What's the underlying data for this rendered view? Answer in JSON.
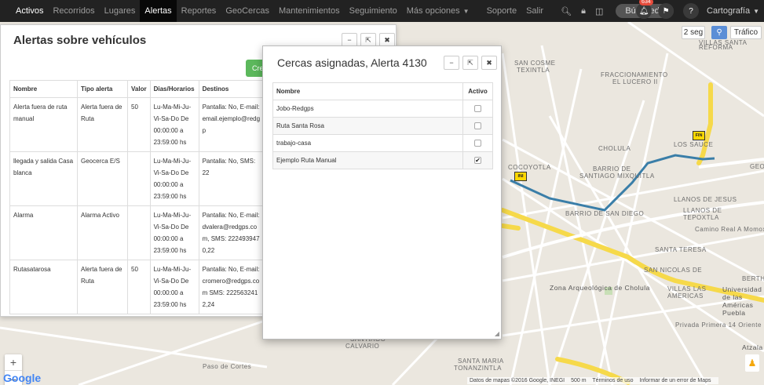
{
  "nav": {
    "items": [
      {
        "label": "Activos",
        "active": false,
        "bold": true
      },
      {
        "label": "Recorridos"
      },
      {
        "label": "Lugares"
      },
      {
        "label": "Alertas",
        "active": true
      },
      {
        "label": "Reportes"
      },
      {
        "label": "GeoCercas"
      },
      {
        "label": "Mantenimientos"
      },
      {
        "label": "Seguimiento"
      },
      {
        "label": "Más opciones"
      }
    ],
    "soporte": "Soporte",
    "salir": "Salir",
    "busqueda": "Búsqueda",
    "notif_count": "634",
    "cartografia": "Cartografía"
  },
  "map": {
    "refresh": "2 seg",
    "trafico": "Tráfico",
    "labels": {
      "reforma": "REFORMA",
      "villas_santa": "VILLAS SANTA",
      "san_cosme": "SAN COSME",
      "texintla": "TEXINTLA",
      "fracc": "FRACCIONAMIENTO",
      "el_lucero": "EL LUCERO II",
      "cholula": "CHOLULA",
      "barrio_santiago": "BARRIO DE",
      "santiago_mixquitla": "SANTIAGO MIXQUITLA",
      "cocoyotla": "COCOYOTLA",
      "barrio_san_diego": "BARRIO DE SAN DIEGO",
      "llanos_jesus": "LLANOS DE JESUS",
      "llanos_tepoxtla": "LLANOS DE",
      "tepoxtla": "TEPOXTLA",
      "santa_teresa": "SANTA TERESA",
      "san_nicolas": "SAN NICOLAS DE",
      "zona_arq": "Zona Arqueológica de Cholula",
      "villas_americas": "VILLAS LAS AMERICAS",
      "udlap": "Universidad de las Américas Puebla",
      "santa_maria": "SANTA MARIA",
      "tonanzintla": "TONANZINTLA",
      "calvario": "CALVARIO",
      "barrio_santiago2": "SANTIAGO",
      "camino_real": "Camino Real A Momoxpan",
      "privada_primera": "Privada Primera 14 Oriente",
      "paso_cortes": "Paso de Cortes",
      "geov": "GEOV",
      "los_sauce": "LOS SAUCE",
      "berth": "BERTH",
      "atzala": "Atzala"
    },
    "attribution": {
      "data": "Datos de mapas ©2016 Google, INEGI",
      "scale": "500 m",
      "terms": "Términos de uso",
      "report": "Informar de un error de Maps"
    },
    "markers": {
      "start": "INI",
      "end": "FIN"
    },
    "google": "Google"
  },
  "alertas_panel": {
    "title": "Alertas sobre vehículos",
    "create_label": "Cre",
    "headers": [
      "Nombre",
      "Tipo alerta",
      "Valor",
      "Dias/Horarios",
      "Destinos"
    ],
    "rows": [
      {
        "nombre": "Alerta fuera de ruta manual",
        "tipo": "Alerta fuera de Ruta",
        "valor": "50",
        "horario": "Lu-Ma-Mi-Ju-Vi-Sa-Do De 00:00:00 a 23:59:00 hs",
        "destinos": "Pantalla: No,  E-mail: email.ejemplo@redgp"
      },
      {
        "nombre": "llegada y salida Casa blanca",
        "tipo": "Geocerca E/S",
        "valor": "",
        "horario": "Lu-Ma-Mi-Ju-Vi-Sa-Do De 00:00:00 a 23:59:00 hs",
        "destinos": "Pantalla: No,  SMS: 22"
      },
      {
        "nombre": "Alarma",
        "tipo": "Alarma Activo",
        "valor": "",
        "horario": "Lu-Ma-Mi-Ju-Vi-Sa-Do De 00:00:00 a 23:59:00 hs",
        "destinos": "Pantalla: No,  E-mail: dvalera@redgps.com, SMS: 2224939470,22"
      },
      {
        "nombre": "Rutasatarosa",
        "tipo": "Alerta fuera de Ruta",
        "valor": "50",
        "horario": "Lu-Ma-Mi-Ju-Vi-Sa-Do De 00:00:00 a 23:59:00 hs",
        "destinos": "Pantalla: No,  E-mail: cromero@redgps.com SMS: 2225632412,24"
      }
    ]
  },
  "cercas_panel": {
    "title": "Cercas asignadas, Alerta 4130",
    "headers": [
      "Nombre",
      "Activo"
    ],
    "rows": [
      {
        "nombre": "Jobo-Redgps",
        "activo": false
      },
      {
        "nombre": "Ruta Santa Rosa",
        "activo": false
      },
      {
        "nombre": "trabajo-casa",
        "activo": false
      },
      {
        "nombre": "Ejemplo Ruta Manual",
        "activo": true
      }
    ]
  },
  "colors": {
    "route": "#3a7ea8",
    "highway": "#f6d94a",
    "road": "#ffffff",
    "green_button": "#5cb85c",
    "badge": "#e74c3c"
  }
}
